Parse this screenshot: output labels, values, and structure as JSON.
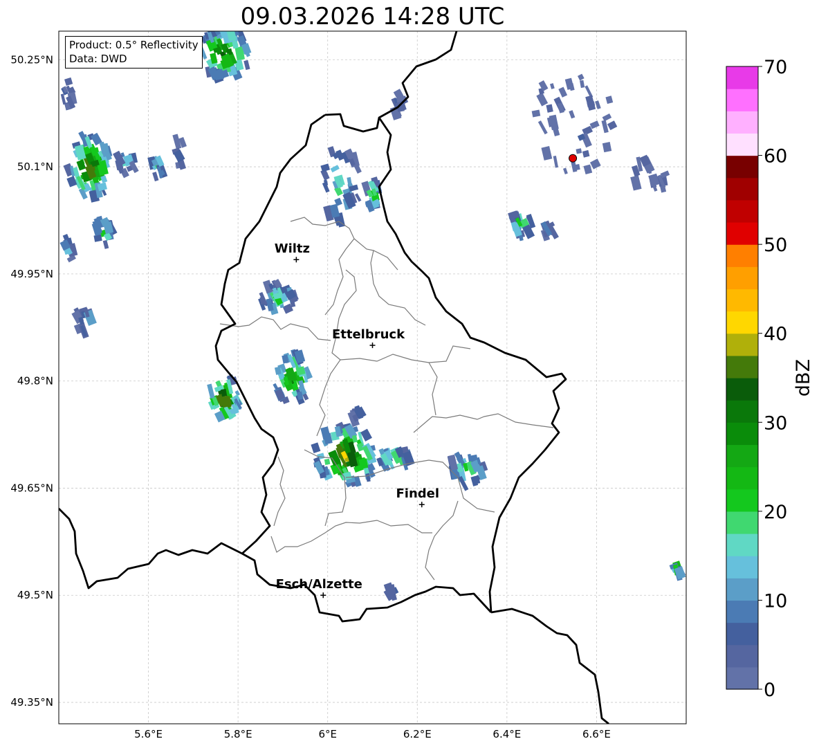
{
  "title": "09.03.2026 14:28 UTC",
  "info": {
    "product": "Product: 0.5° Reflectivity",
    "source": "Data: DWD"
  },
  "map": {
    "lon_range": [
      5.4,
      6.8
    ],
    "lat_range": [
      49.32,
      50.29
    ],
    "lon_ticks": [
      {
        "value": 5.6,
        "label": "5.6°E"
      },
      {
        "value": 5.8,
        "label": "5.8°E"
      },
      {
        "value": 6.0,
        "label": "6°E"
      },
      {
        "value": 6.2,
        "label": "6.2°E"
      },
      {
        "value": 6.4,
        "label": "6.4°E"
      },
      {
        "value": 6.6,
        "label": "6.6°E"
      }
    ],
    "lat_ticks": [
      {
        "value": 50.25,
        "label": "50.25°N"
      },
      {
        "value": 50.1,
        "label": "50.1°N"
      },
      {
        "value": 49.95,
        "label": "49.95°N"
      },
      {
        "value": 49.8,
        "label": "49.8°N"
      },
      {
        "value": 49.65,
        "label": "49.65°N"
      },
      {
        "value": 49.5,
        "label": "49.5°N"
      },
      {
        "value": 49.35,
        "label": "49.35°N"
      }
    ],
    "cities": [
      {
        "name": "Wiltz",
        "lon": 5.93,
        "lat": 49.97
      },
      {
        "name": "Ettelbruck",
        "lon": 6.1,
        "lat": 49.85
      },
      {
        "name": "Findel",
        "lon": 6.21,
        "lat": 49.627
      },
      {
        "name": "Esch/Alzette",
        "lon": 5.99,
        "lat": 49.5
      }
    ],
    "radar_site": {
      "lon": 6.547,
      "lat": 50.112,
      "color": "#e00000"
    }
  },
  "colorbar": {
    "label": "dBZ",
    "min": 0,
    "max": 70,
    "tick_labels": [
      "0",
      "10",
      "20",
      "30",
      "40",
      "50",
      "60",
      "70"
    ],
    "colors": [
      "#6272a8",
      "#5566a0",
      "#44609e",
      "#4b7bb4",
      "#5b9ec8",
      "#66c0dc",
      "#60d8c4",
      "#40d870",
      "#14c81e",
      "#14b814",
      "#14a814",
      "#0a8c0a",
      "#0a780a",
      "#0a5c0a",
      "#447a0a",
      "#b0b00a",
      "#ffd700",
      "#ffb900",
      "#ff9f00",
      "#ff7f00",
      "#e00000",
      "#c00000",
      "#a00000",
      "#780000",
      "#ffe0ff",
      "#ffb0ff",
      "#ff70ff",
      "#e83ae8"
    ]
  },
  "echoes": [
    {
      "lon": 5.77,
      "lat": 50.26,
      "rx": 0.06,
      "ry": 0.035,
      "peak": 36,
      "n": 55
    },
    {
      "lon": 5.47,
      "lat": 50.1,
      "rx": 0.05,
      "ry": 0.045,
      "peak": 38,
      "n": 60
    },
    {
      "lon": 5.55,
      "lat": 50.105,
      "rx": 0.02,
      "ry": 0.015,
      "peak": 20,
      "n": 12
    },
    {
      "lon": 5.62,
      "lat": 50.1,
      "rx": 0.015,
      "ry": 0.015,
      "peak": 22,
      "n": 10
    },
    {
      "lon": 5.42,
      "lat": 50.2,
      "rx": 0.012,
      "ry": 0.02,
      "peak": 8,
      "n": 10
    },
    {
      "lon": 5.42,
      "lat": 49.98,
      "rx": 0.01,
      "ry": 0.02,
      "peak": 18,
      "n": 8
    },
    {
      "lon": 5.5,
      "lat": 50.01,
      "rx": 0.02,
      "ry": 0.02,
      "peak": 26,
      "n": 16
    },
    {
      "lon": 5.46,
      "lat": 49.885,
      "rx": 0.02,
      "ry": 0.018,
      "peak": 14,
      "n": 12
    },
    {
      "lon": 5.77,
      "lat": 49.775,
      "rx": 0.035,
      "ry": 0.03,
      "peak": 40,
      "n": 35
    },
    {
      "lon": 5.92,
      "lat": 49.805,
      "rx": 0.04,
      "ry": 0.035,
      "peak": 32,
      "n": 40
    },
    {
      "lon": 5.89,
      "lat": 49.915,
      "rx": 0.04,
      "ry": 0.022,
      "peak": 20,
      "n": 30
    },
    {
      "lon": 6.03,
      "lat": 50.075,
      "rx": 0.04,
      "ry": 0.06,
      "peak": 18,
      "n": 32
    },
    {
      "lon": 6.1,
      "lat": 50.06,
      "rx": 0.015,
      "ry": 0.022,
      "peak": 30,
      "n": 16
    },
    {
      "lon": 6.04,
      "lat": 49.695,
      "rx": 0.07,
      "ry": 0.04,
      "peak": 42,
      "n": 70
    },
    {
      "lon": 6.15,
      "lat": 49.69,
      "rx": 0.035,
      "ry": 0.012,
      "peak": 30,
      "n": 22
    },
    {
      "lon": 6.31,
      "lat": 49.675,
      "rx": 0.04,
      "ry": 0.02,
      "peak": 26,
      "n": 24
    },
    {
      "lon": 6.43,
      "lat": 50.02,
      "rx": 0.025,
      "ry": 0.015,
      "peak": 24,
      "n": 14
    },
    {
      "lon": 6.495,
      "lat": 50.01,
      "rx": 0.012,
      "ry": 0.01,
      "peak": 12,
      "n": 8
    },
    {
      "lon": 6.78,
      "lat": 49.54,
      "rx": 0.01,
      "ry": 0.02,
      "peak": 24,
      "n": 8
    },
    {
      "lon": 5.67,
      "lat": 50.12,
      "rx": 0.01,
      "ry": 0.02,
      "peak": 8,
      "n": 6
    },
    {
      "lon": 6.14,
      "lat": 49.505,
      "rx": 0.015,
      "ry": 0.01,
      "peak": 8,
      "n": 6
    },
    {
      "lon": 6.07,
      "lat": 49.75,
      "rx": 0.015,
      "ry": 0.01,
      "peak": 8,
      "n": 6
    },
    {
      "lon": 6.55,
      "lat": 50.17,
      "rx": 0.09,
      "ry": 0.08,
      "peak": 4,
      "n": 40
    },
    {
      "lon": 6.72,
      "lat": 50.09,
      "rx": 0.04,
      "ry": 0.03,
      "peak": 4,
      "n": 14
    },
    {
      "lon": 6.16,
      "lat": 50.19,
      "rx": 0.015,
      "ry": 0.02,
      "peak": 4,
      "n": 8
    }
  ]
}
